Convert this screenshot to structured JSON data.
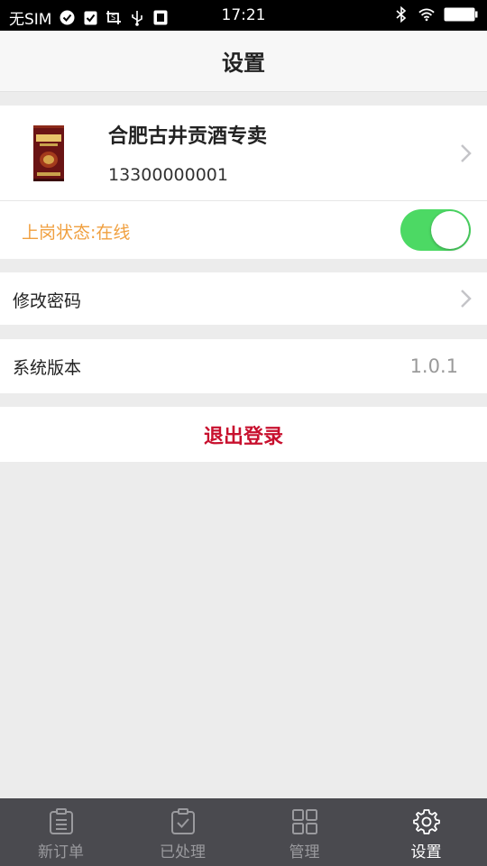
{
  "status_bar": {
    "carrier": "无SIM",
    "time": "17:21"
  },
  "nav": {
    "title": "设置"
  },
  "profile": {
    "name": "合肥古井贡酒专卖",
    "phone": "13300000001"
  },
  "duty": {
    "label": "上岗状态:在线",
    "enabled": true,
    "label_color": "#f0a040",
    "toggle_color": "#4cd964"
  },
  "settings": {
    "change_password": "修改密码",
    "version_label": "系统版本",
    "version_value": "1.0.1"
  },
  "logout": {
    "label": "退出登录",
    "color": "#c8102e"
  },
  "tabs": [
    {
      "label": "新订单",
      "icon": "clipboard-list-icon",
      "active": false
    },
    {
      "label": "已处理",
      "icon": "clipboard-check-icon",
      "active": false
    },
    {
      "label": "管理",
      "icon": "grid-icon",
      "active": false
    },
    {
      "label": "设置",
      "icon": "gear-icon",
      "active": true
    }
  ]
}
